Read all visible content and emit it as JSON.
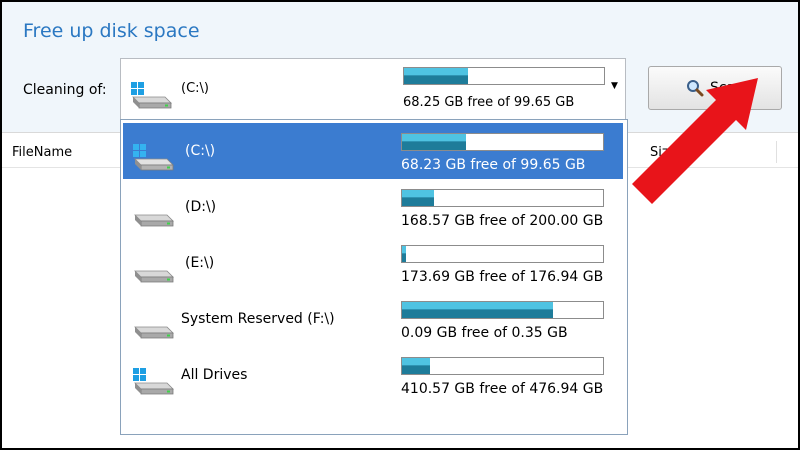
{
  "window": {
    "title": "Free up disk space"
  },
  "toolbar": {
    "cleaning_label": "Cleaning of:",
    "scan_label": "Scan",
    "scan_icon": "magnifier-icon"
  },
  "combo": {
    "selected_name": "(C:\\)",
    "selected_free": "68.25 GB free of 99.65 GB",
    "usage_fraction": 0.32,
    "icon": "windows-drive-icon"
  },
  "list": {
    "columns": {
      "filename": "FileName",
      "size": "Size"
    }
  },
  "dropdown": {
    "items": [
      {
        "name": "(C:\\)",
        "free": "68.23 GB free of 99.65 GB",
        "usage_fraction": 0.32,
        "icon": "windows-drive-icon",
        "selected": true
      },
      {
        "name": "(D:\\)",
        "free": "168.57 GB free of 200.00 GB",
        "usage_fraction": 0.16,
        "icon": "drive-icon",
        "selected": false
      },
      {
        "name": "(E:\\)",
        "free": "173.69 GB free of 176.94 GB",
        "usage_fraction": 0.02,
        "icon": "drive-icon",
        "selected": false
      },
      {
        "name": "System Reserved (F:\\)",
        "free": "0.09 GB free of 0.35 GB",
        "usage_fraction": 0.75,
        "icon": "drive-icon",
        "selected": false
      },
      {
        "name": "All Drives",
        "free": "410.57 GB free of 476.94 GB",
        "usage_fraction": 0.14,
        "icon": "windows-drive-icon",
        "selected": false
      }
    ]
  },
  "colors": {
    "title": "#2b78c2",
    "selection": "#3b7cd0",
    "bar_light": "#4fc3e2",
    "bar_dark": "#1e7c9a",
    "annotation_arrow": "#e8141a"
  }
}
